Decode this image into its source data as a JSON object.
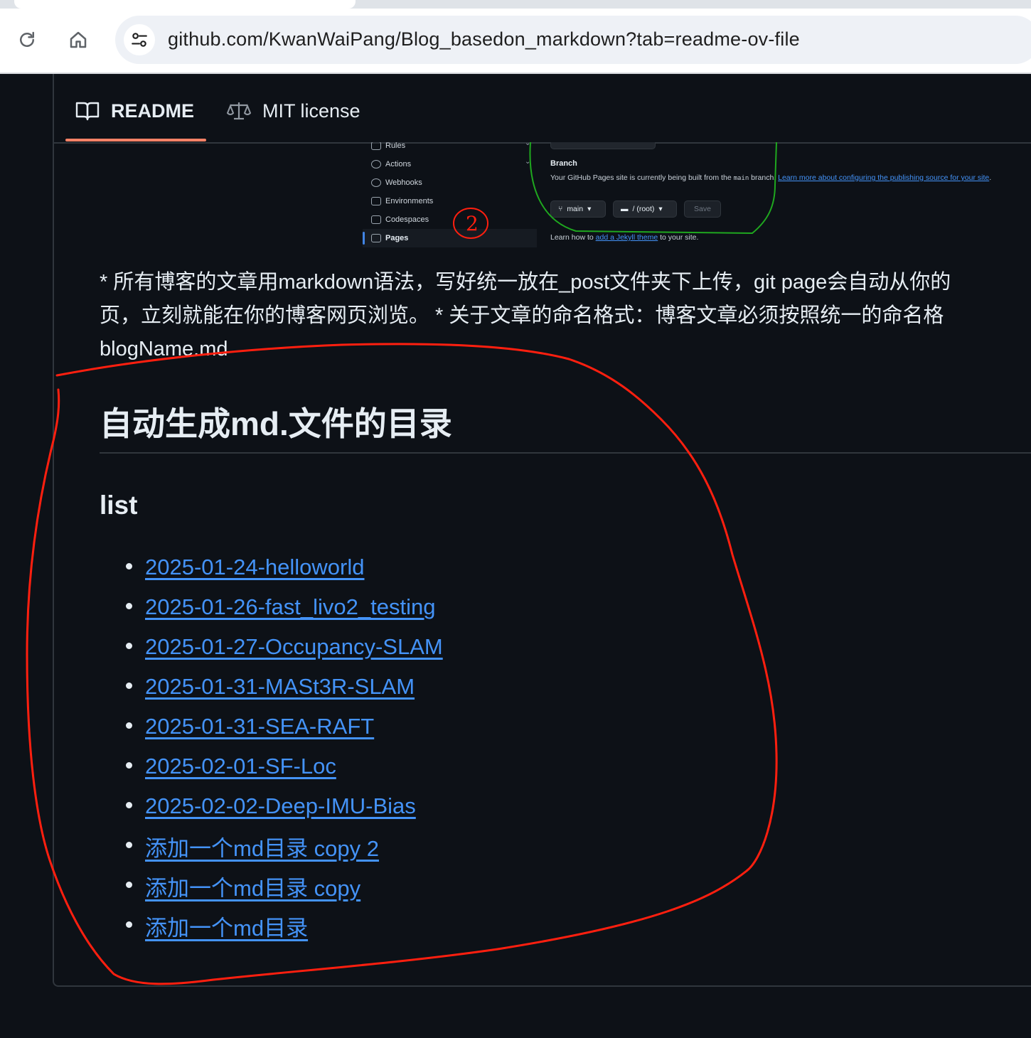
{
  "browser": {
    "url": "github.com/KwanWaiPang/Blog_basedon_markdown?tab=readme-ov-file",
    "reload_icon": "reload-icon",
    "home_icon": "home-icon",
    "site_info_icon": "tune-icon"
  },
  "tabs": {
    "readme_label": "README",
    "license_label": "MIT license"
  },
  "embedded_screenshot": {
    "menu": [
      "Rules",
      "Actions",
      "Webhooks",
      "Environments",
      "Codespaces",
      "Pages"
    ],
    "branch_heading": "Branch",
    "branch_text_1": "Your GitHub Pages site is currently being built from the ",
    "branch_code": "main",
    "branch_text_2": " branch. ",
    "branch_link": "Learn more about configuring the publishing source for your site",
    "branch_button": "main",
    "folder_button": "/ (root)",
    "save_button": "Save",
    "learn_text_1": "Learn how to ",
    "learn_link": "add a Jekyll theme",
    "learn_text_2": " to your site.",
    "annotation_number": "2"
  },
  "content": {
    "paragraph_line1": "* 所有博客的文章用markdown语法，写好统一放在_post文件夹下上传，git page会自动从你的",
    "paragraph_line2": "页，立刻就能在你的博客网页浏览。 * 关于文章的命名格式：博客文章必须按照统一的命名格",
    "paragraph_line3": "blogName.md",
    "h2": "自动生成md.文件的目录",
    "h3": "list",
    "links": [
      "2025-01-24-helloworld",
      "2025-01-26-fast_livo2_testing",
      "2025-01-27-Occupancy-SLAM",
      "2025-01-31-MASt3R-SLAM",
      "2025-01-31-SEA-RAFT",
      "2025-02-01-SF-Loc",
      "2025-02-02-Deep-IMU-Bias",
      "添加一个md目录 copy 2",
      "添加一个md目录 copy",
      "添加一个md目录"
    ]
  },
  "colors": {
    "background": "#0d1117",
    "link": "#4493f8",
    "tab_underline": "#f78166",
    "annotation_red": "#ff1f0f",
    "annotation_green": "#1fa81f"
  }
}
